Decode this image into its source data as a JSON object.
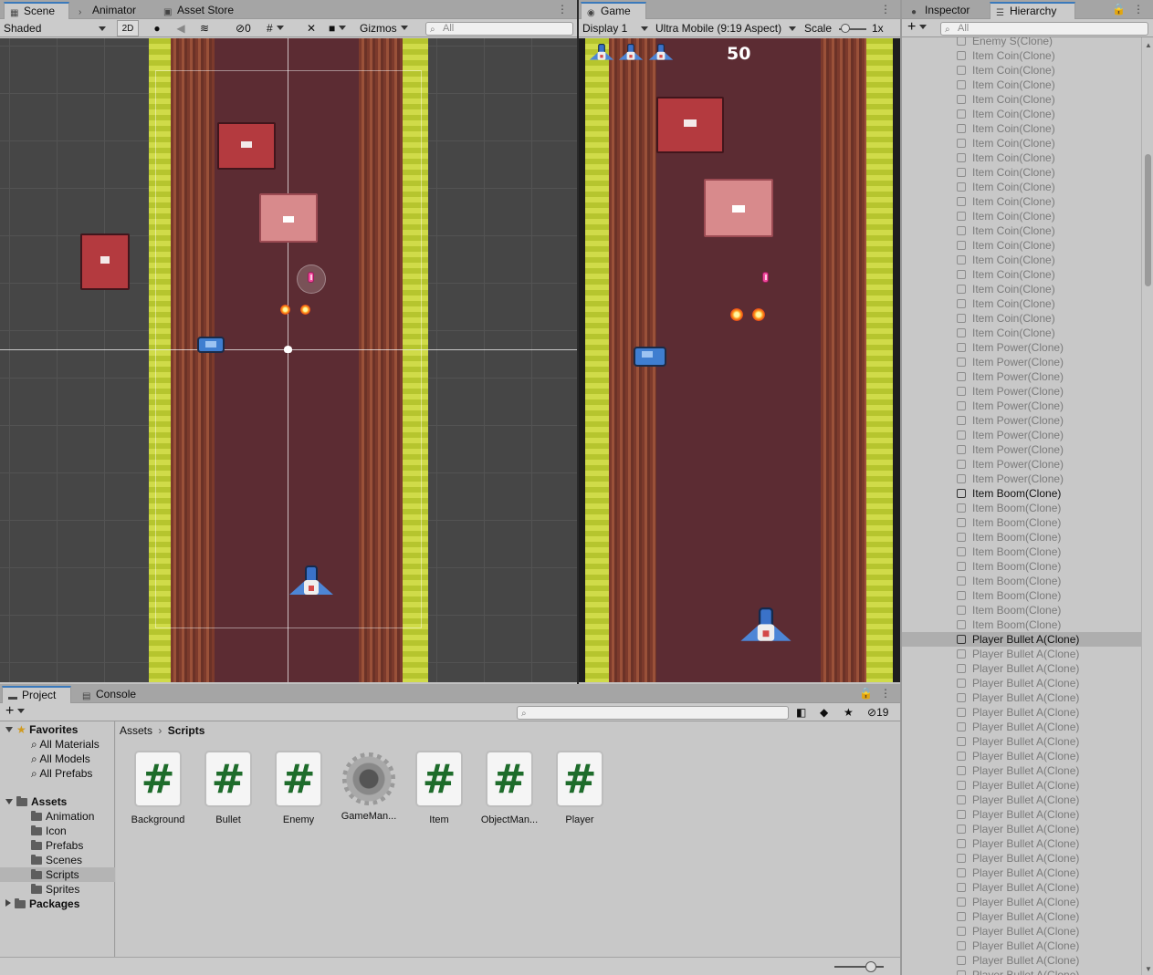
{
  "scene": {
    "tabs": [
      "Scene",
      "Animator",
      "Asset Store"
    ],
    "shading_mode": "Shaded",
    "mode_2d": "2D",
    "hidden_count": "0",
    "gizmos_label": "Gizmos",
    "search_placeholder": "All"
  },
  "game": {
    "tab": "Game",
    "display": "Display 1",
    "aspect": "Ultra Mobile (9:19 Aspect)",
    "scale_label": "Scale",
    "scale_value": "1x",
    "score": "50",
    "lives": 3
  },
  "inspector_tab": "Inspector",
  "hierarchy": {
    "tab": "Hierarchy",
    "search_placeholder": "All",
    "rows": [
      {
        "label": "Enemy S(Clone)",
        "state": "inactive"
      },
      {
        "label": "Item Coin(Clone)",
        "state": "inactive"
      },
      {
        "label": "Item Coin(Clone)",
        "state": "inactive"
      },
      {
        "label": "Item Coin(Clone)",
        "state": "inactive"
      },
      {
        "label": "Item Coin(Clone)",
        "state": "inactive"
      },
      {
        "label": "Item Coin(Clone)",
        "state": "inactive"
      },
      {
        "label": "Item Coin(Clone)",
        "state": "inactive"
      },
      {
        "label": "Item Coin(Clone)",
        "state": "inactive"
      },
      {
        "label": "Item Coin(Clone)",
        "state": "inactive"
      },
      {
        "label": "Item Coin(Clone)",
        "state": "inactive"
      },
      {
        "label": "Item Coin(Clone)",
        "state": "inactive"
      },
      {
        "label": "Item Coin(Clone)",
        "state": "inactive"
      },
      {
        "label": "Item Coin(Clone)",
        "state": "inactive"
      },
      {
        "label": "Item Coin(Clone)",
        "state": "inactive"
      },
      {
        "label": "Item Coin(Clone)",
        "state": "inactive"
      },
      {
        "label": "Item Coin(Clone)",
        "state": "inactive"
      },
      {
        "label": "Item Coin(Clone)",
        "state": "inactive"
      },
      {
        "label": "Item Coin(Clone)",
        "state": "inactive"
      },
      {
        "label": "Item Coin(Clone)",
        "state": "inactive"
      },
      {
        "label": "Item Coin(Clone)",
        "state": "inactive"
      },
      {
        "label": "Item Coin(Clone)",
        "state": "inactive"
      },
      {
        "label": "Item Power(Clone)",
        "state": "inactive"
      },
      {
        "label": "Item Power(Clone)",
        "state": "inactive"
      },
      {
        "label": "Item Power(Clone)",
        "state": "inactive"
      },
      {
        "label": "Item Power(Clone)",
        "state": "inactive"
      },
      {
        "label": "Item Power(Clone)",
        "state": "inactive"
      },
      {
        "label": "Item Power(Clone)",
        "state": "inactive"
      },
      {
        "label": "Item Power(Clone)",
        "state": "inactive"
      },
      {
        "label": "Item Power(Clone)",
        "state": "inactive"
      },
      {
        "label": "Item Power(Clone)",
        "state": "inactive"
      },
      {
        "label": "Item Power(Clone)",
        "state": "inactive"
      },
      {
        "label": "Item Boom(Clone)",
        "state": "active"
      },
      {
        "label": "Item Boom(Clone)",
        "state": "inactive"
      },
      {
        "label": "Item Boom(Clone)",
        "state": "inactive"
      },
      {
        "label": "Item Boom(Clone)",
        "state": "inactive"
      },
      {
        "label": "Item Boom(Clone)",
        "state": "inactive"
      },
      {
        "label": "Item Boom(Clone)",
        "state": "inactive"
      },
      {
        "label": "Item Boom(Clone)",
        "state": "inactive"
      },
      {
        "label": "Item Boom(Clone)",
        "state": "inactive"
      },
      {
        "label": "Item Boom(Clone)",
        "state": "inactive"
      },
      {
        "label": "Item Boom(Clone)",
        "state": "inactive"
      },
      {
        "label": "Player Bullet A(Clone)",
        "state": "selected"
      },
      {
        "label": "Player Bullet A(Clone)",
        "state": "inactive"
      },
      {
        "label": "Player Bullet A(Clone)",
        "state": "inactive"
      },
      {
        "label": "Player Bullet A(Clone)",
        "state": "inactive"
      },
      {
        "label": "Player Bullet A(Clone)",
        "state": "inactive"
      },
      {
        "label": "Player Bullet A(Clone)",
        "state": "inactive"
      },
      {
        "label": "Player Bullet A(Clone)",
        "state": "inactive"
      },
      {
        "label": "Player Bullet A(Clone)",
        "state": "inactive"
      },
      {
        "label": "Player Bullet A(Clone)",
        "state": "inactive"
      },
      {
        "label": "Player Bullet A(Clone)",
        "state": "inactive"
      },
      {
        "label": "Player Bullet A(Clone)",
        "state": "inactive"
      },
      {
        "label": "Player Bullet A(Clone)",
        "state": "inactive"
      },
      {
        "label": "Player Bullet A(Clone)",
        "state": "inactive"
      },
      {
        "label": "Player Bullet A(Clone)",
        "state": "inactive"
      },
      {
        "label": "Player Bullet A(Clone)",
        "state": "inactive"
      },
      {
        "label": "Player Bullet A(Clone)",
        "state": "inactive"
      },
      {
        "label": "Player Bullet A(Clone)",
        "state": "inactive"
      },
      {
        "label": "Player Bullet A(Clone)",
        "state": "inactive"
      },
      {
        "label": "Player Bullet A(Clone)",
        "state": "inactive"
      },
      {
        "label": "Player Bullet A(Clone)",
        "state": "inactive"
      },
      {
        "label": "Player Bullet A(Clone)",
        "state": "inactive"
      },
      {
        "label": "Player Bullet A(Clone)",
        "state": "inactive"
      },
      {
        "label": "Player Bullet A(Clone)",
        "state": "inactive"
      },
      {
        "label": "Player Bullet A(Clone)",
        "state": "inactive"
      }
    ]
  },
  "project": {
    "tabs": [
      "Project",
      "Console"
    ],
    "hidden_count": "19",
    "favorites": {
      "label": "Favorites",
      "items": [
        "All Materials",
        "All Models",
        "All Prefabs"
      ]
    },
    "assets": {
      "label": "Assets",
      "folders": [
        "Animation",
        "Icon",
        "Prefabs",
        "Scenes",
        "Scripts",
        "Sprites"
      ],
      "selected": "Scripts"
    },
    "packages_label": "Packages",
    "breadcrumb": [
      "Assets",
      "Scripts"
    ],
    "files": [
      {
        "name": "Background",
        "icon": "csharp-script-icon"
      },
      {
        "name": "Bullet",
        "icon": "csharp-script-icon"
      },
      {
        "name": "Enemy",
        "icon": "csharp-script-icon"
      },
      {
        "name": "GameMan...",
        "icon": "gear-icon"
      },
      {
        "name": "Item",
        "icon": "csharp-script-icon"
      },
      {
        "name": "ObjectMan...",
        "icon": "csharp-script-icon"
      },
      {
        "name": "Player",
        "icon": "csharp-script-icon"
      }
    ]
  },
  "colors": {
    "tab_accent": "#3a79bb",
    "grass": "#c7d33a",
    "road": "#5c2c33",
    "enemy_red": "#b43a3f",
    "player_blue": "#3a72c9"
  }
}
